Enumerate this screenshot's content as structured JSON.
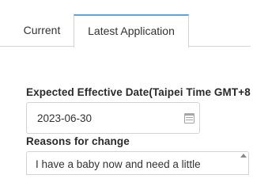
{
  "tabs": [
    {
      "label": "Current",
      "active": false
    },
    {
      "label": "Latest Application",
      "active": true
    }
  ],
  "form": {
    "effective_date_label": "Expected Effective Date(Taipei Time GMT+8",
    "effective_date_value": "2023-06-30",
    "reason_label": "Reasons for change",
    "reason_value": "I have a baby now and need a little"
  },
  "colors": {
    "active_tab_accent": "#5aa3dc",
    "border": "#d6d6d6"
  },
  "icons": {
    "date_picker": "calendar-icon",
    "textarea_scroll": "scroll-up-arrow-icon"
  }
}
